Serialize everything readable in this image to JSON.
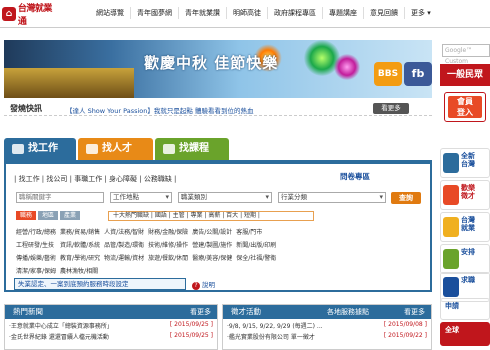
{
  "header": {
    "logo_text": "台灣就業通",
    "nav": [
      "網站導覽",
      "青年國夢網",
      "青年就業讚",
      "明師高徒",
      "政府課程專區",
      "專題講座",
      "意見回饋",
      "更多 ▾"
    ]
  },
  "banner": {
    "text": "歡慶中秋 佳節快樂",
    "bbs_label": "BBS",
    "fb_label": "fb"
  },
  "sidebar": {
    "search_placeholder": "Google™ Custom",
    "title": "一般民眾",
    "login_label": "會員\n登入",
    "ads": [
      {
        "text": "全新\n台灣"
      },
      {
        "text": "歡樂\n徵才"
      },
      {
        "text": "台灣\n就業"
      },
      {
        "text": "安排"
      },
      {
        "text": "求職"
      },
      {
        "text": "申請"
      },
      {
        "text": "全球"
      }
    ]
  },
  "quick": {
    "label": "發燒快訊",
    "message": "【達人 Show Your Passion】我就只是起點 體驗看看到位的熱血",
    "more_label": "看更多"
  },
  "tabs": [
    {
      "label": "找工作",
      "color": "#2c6c9c"
    },
    {
      "label": "找人才",
      "color": "#e88a17"
    },
    {
      "label": "找課程",
      "color": "#6aa32b"
    }
  ],
  "job_panel": {
    "subnav": "| 找工作 | 找公司 | 事職工作 | 身心障礙 | 公務職缺 |",
    "hot_label": "問卷專區",
    "keyword_placeholder": "職稱關鍵字",
    "area_select": "工作地點",
    "category_select": "職業類別",
    "industry_select": "行業分類",
    "search_btn": "查詢",
    "chips": [
      "職務",
      "地區",
      "產業"
    ],
    "hot_keywords": "十大熱門職缺 | 國語 | 主管 | 專業 | 高薪 | 百大 | 短期 |",
    "categories": [
      "經營/行政/總務",
      "業務/貿易/銷售",
      "人資/法務/智財",
      "財務/金融/保險",
      "廣告/公關/設計",
      "客服/門市",
      "工程研發/生技",
      "資訊/軟體/系統",
      "品管/製造/環衛",
      "技術/維修/操作",
      "營建/製圖/施作",
      "新聞/出版/印刷",
      "傳播/娛樂/藝術",
      "教育/學術/研究",
      "物流/運輸/資材",
      "旅遊/餐飲/休閒",
      "醫療/美容/保健",
      "保全/社福/警衛",
      "清潔/家事/保姆",
      "農林漁牧/相關"
    ],
    "law_label": "失業認定、一案到底預約服務時段設定",
    "help_label": "說明"
  },
  "news": {
    "title": "熱門新聞",
    "more_label": "看更多",
    "items": [
      {
        "text": "‧王意就業中心成立「總裝資源事務所」",
        "date": "[ 2015/09/25 ]"
      },
      {
        "text": "‧金氏世界紀錄 還還冒續人檔元機活動",
        "date": "[ 2015/09/25 ]"
      }
    ]
  },
  "talent": {
    "title": "徵才活動",
    "mid_label": "各地服務據點",
    "more_label": "看更多",
    "items": [
      {
        "text": "‧9/8, 9/15, 9/22, 9/29 (每週二) ...",
        "date": "[ 2015/09/08 ]"
      },
      {
        "text": "‧艦光實業股份有限公司 單一徵才",
        "date": "[ 2015/09/22 ]"
      }
    ]
  }
}
